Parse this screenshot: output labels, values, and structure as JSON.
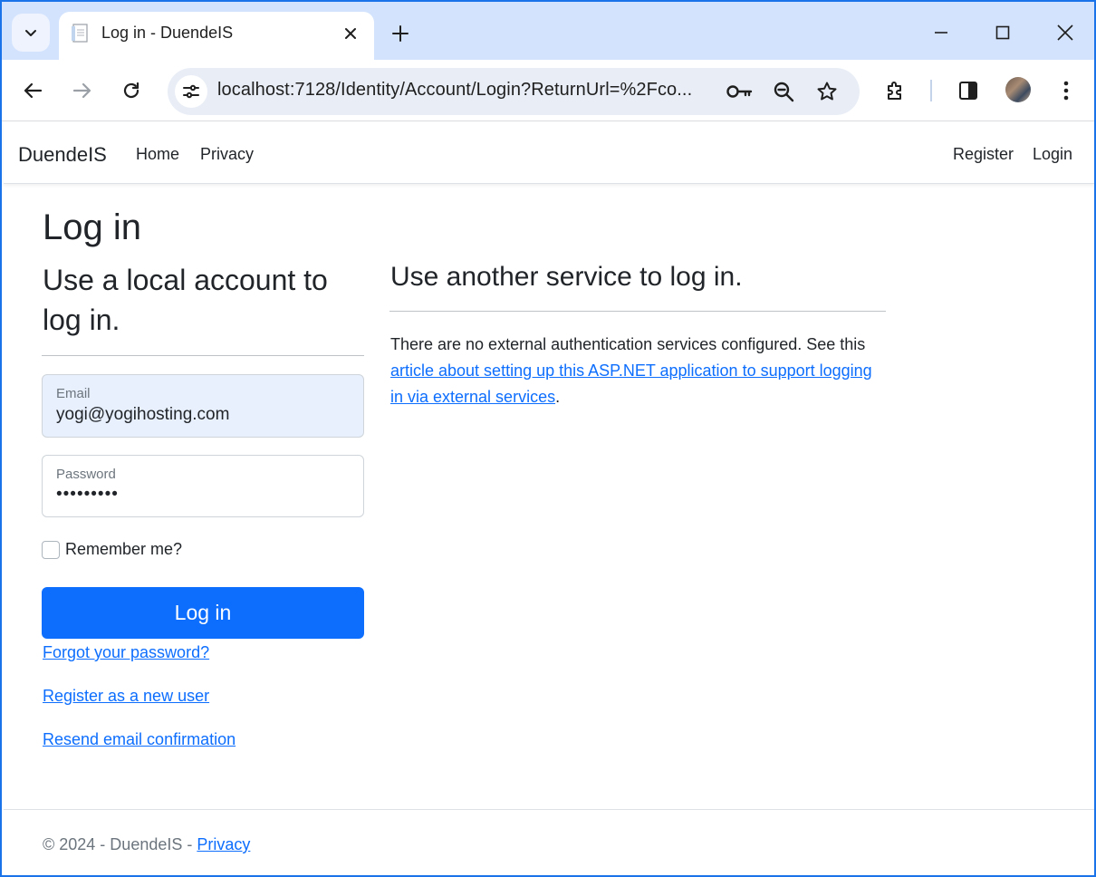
{
  "browser": {
    "tab_title": "Log in - DuendeIS",
    "url": "localhost:7128/Identity/Account/Login?ReturnUrl=%2Fco..."
  },
  "navbar": {
    "brand": "DuendeIS",
    "links": [
      "Home",
      "Privacy"
    ],
    "right_links": [
      "Register",
      "Login"
    ]
  },
  "page": {
    "title": "Log in",
    "local_heading": "Use a local account to log in.",
    "external_heading": "Use another service to log in.",
    "external_text_before": "There are no external authentication services configured. See this ",
    "external_link": "article about setting up this ASP.NET application to support logging in via external services",
    "external_text_after": "."
  },
  "form": {
    "email_label": "Email",
    "email_value": "yogi@yogihosting.com",
    "password_label": "Password",
    "password_value": "•••••••••",
    "remember_label": "Remember me?",
    "remember_checked": false,
    "submit_label": "Log in",
    "links": [
      "Forgot your password?",
      "Register as a new user",
      "Resend email confirmation"
    ]
  },
  "footer": {
    "text": "© 2024 - DuendeIS - ",
    "privacy_link": "Privacy"
  },
  "colors": {
    "primary": "#0d6efd",
    "tabstrip": "#d3e3fd",
    "autofill": "#e8f0fe"
  }
}
